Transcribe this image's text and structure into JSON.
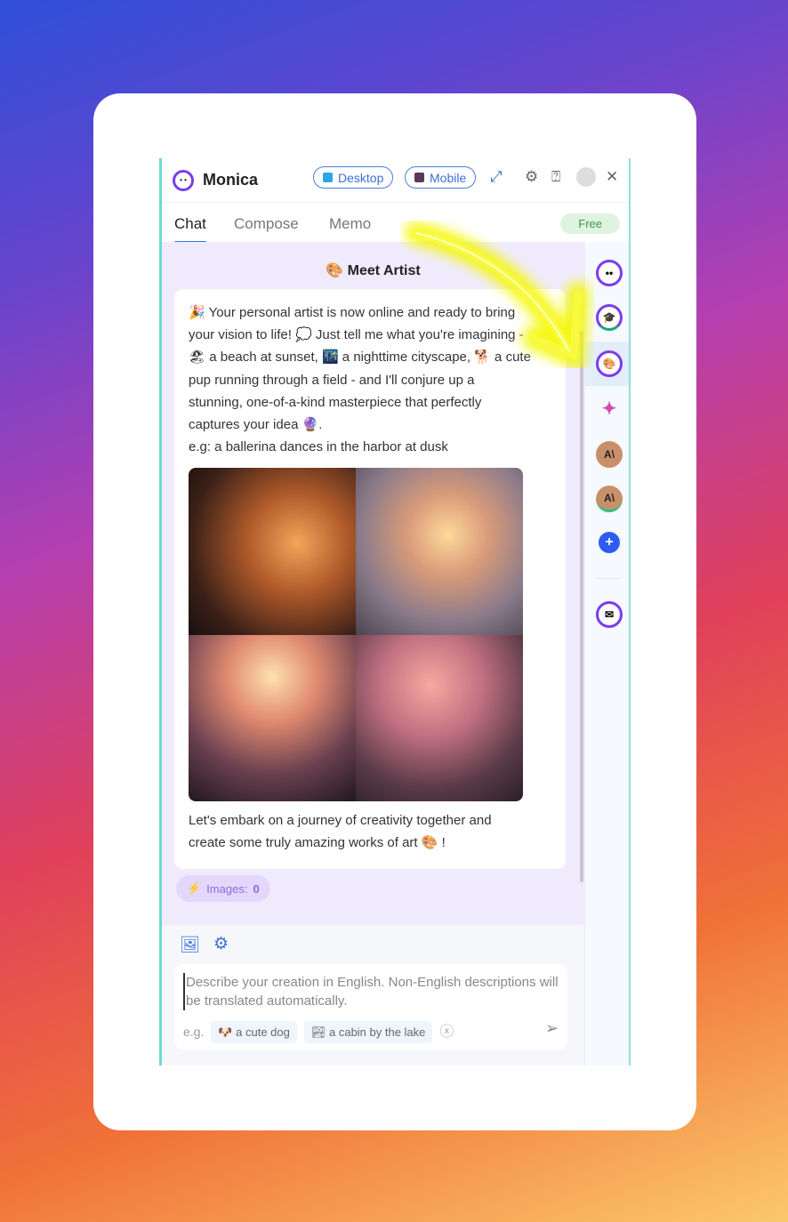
{
  "app": {
    "title": "Monica",
    "desktop_label": "Desktop",
    "mobile_label": "Mobile",
    "free_badge": "Free"
  },
  "tabs": [
    {
      "label": "Chat",
      "active": true
    },
    {
      "label": "Compose"
    },
    {
      "label": "Memo"
    }
  ],
  "chat": {
    "bot_name": "Meet Artist",
    "message_lines": [
      "🎉 Your personal artist is now online and ready to bring",
      "your vision to life! 💭 Just tell me what you're imagining -",
      "🏖 a beach at sunset, 🌃 a nighttime cityscape, 🐕 a cute",
      "pup running through a field - and I'll conjure up a",
      "stunning, one-of-a-kind masterpiece that perfectly",
      "captures your idea 🔮.",
      "e.g: a ballerina dances in the harbor at dusk"
    ],
    "footer_lines": [
      "Let's embark on a journey of creativity together and",
      "create some truly amazing works of art 🎨 !"
    ],
    "images_label": "Images:",
    "images_count": "0"
  },
  "composer": {
    "placeholder": "Describe your creation in English. Non-English descriptions will be translated automatically.",
    "example_label": "e.g.",
    "examples": [
      "🐶 a cute dog",
      "🏞 a cabin by the lake"
    ]
  },
  "sidebar": {
    "icons": [
      "monica-bot-icon",
      "gpt4-bot-icon",
      "artist-bot-icon",
      "gemini-bot-icon",
      "claude-bot-icon",
      "claude-new-bot-icon",
      "add-bot-icon",
      "mail-bot-icon"
    ]
  },
  "colors": {
    "accent": "#3573e0",
    "chat_bg": "#f0ebfc",
    "annotation_arrow": "#f4f800"
  }
}
